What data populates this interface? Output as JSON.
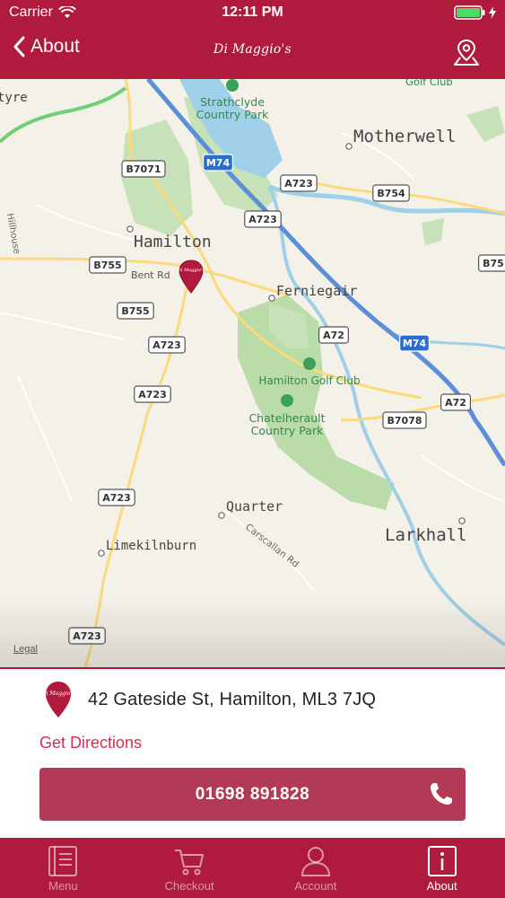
{
  "status_bar": {
    "carrier": "Carrier",
    "time": "12:11 PM"
  },
  "nav": {
    "back_label": "About",
    "logo_text": "Di Maggio's"
  },
  "map": {
    "legal": "Legal",
    "labels": [
      {
        "id": "motherwell",
        "text": "Motherwell"
      },
      {
        "id": "hamilton",
        "text": "Hamilton"
      },
      {
        "id": "ferniegair",
        "text": "Ferniegair"
      },
      {
        "id": "quarter",
        "text": "Quarter"
      },
      {
        "id": "larkhall",
        "text": "Larkhall"
      },
      {
        "id": "limekilnburn",
        "text": "Limekilnburn"
      },
      {
        "id": "strathclyde",
        "text": "Strathclyde Country Park"
      },
      {
        "id": "golfclub-top",
        "text": "Golf Club"
      },
      {
        "id": "hamilton-golf",
        "text": "Hamilton Golf Club"
      },
      {
        "id": "chatelherault",
        "text": "Chatelherault Country Park"
      },
      {
        "id": "bentrd",
        "text": "Bent Rd"
      },
      {
        "id": "carscallan",
        "text": "Carscallan Rd"
      },
      {
        "id": "hillhouse",
        "text": "Hillhouse"
      },
      {
        "id": "tyre",
        "text": "tyre"
      }
    ],
    "road_badges": [
      "B7071",
      "M74",
      "A723",
      "A723",
      "B754",
      "B755",
      "B755",
      "A723",
      "A72",
      "M74",
      "A723",
      "B7078",
      "A72",
      "A723",
      "A723",
      "B75"
    ]
  },
  "info": {
    "address": "42 Gateside St, Hamilton, ML3 7JQ",
    "directions_label": "Get Directions",
    "phone": "01698 891828"
  },
  "tabs": [
    {
      "id": "menu",
      "label": "Menu",
      "active": false
    },
    {
      "id": "checkout",
      "label": "Checkout",
      "active": false
    },
    {
      "id": "account",
      "label": "Account",
      "active": false
    },
    {
      "id": "about",
      "label": "About",
      "active": true
    }
  ],
  "colors": {
    "brand": "#b01a3c",
    "button": "#b23a56",
    "link": "#d2304e"
  }
}
